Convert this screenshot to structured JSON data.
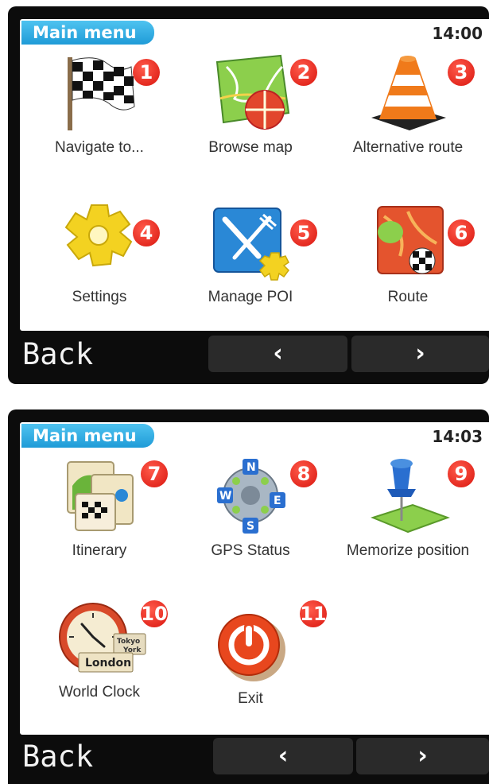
{
  "screens": [
    {
      "title": "Main menu",
      "clock": "14:00",
      "items": [
        {
          "label": "Navigate to...",
          "badge": "1",
          "icon": "checkered-flag-icon"
        },
        {
          "label": "Browse map",
          "badge": "2",
          "icon": "map-icon"
        },
        {
          "label": "Alternative route",
          "badge": "3",
          "icon": "traffic-cone-icon"
        },
        {
          "label": "Settings",
          "badge": "4",
          "icon": "gear-icon"
        },
        {
          "label": "Manage POI",
          "badge": "5",
          "icon": "fork-knife-poi-icon"
        },
        {
          "label": "Route",
          "badge": "6",
          "icon": "route-map-icon"
        }
      ],
      "back_label": "Back",
      "prev_label": "‹",
      "next_label": "›"
    },
    {
      "title": "Main menu",
      "clock": "14:03",
      "items": [
        {
          "label": "Itinerary",
          "badge": "7",
          "icon": "itinerary-icon"
        },
        {
          "label": "GPS Status",
          "badge": "8",
          "icon": "compass-icon"
        },
        {
          "label": "Memorize position",
          "badge": "9",
          "icon": "pushpin-icon"
        },
        {
          "label": "World Clock",
          "badge": "10",
          "icon": "clock-icon",
          "sign_top": "Tokyo",
          "sign_mid": "York",
          "sign_main": "London"
        },
        {
          "label": "Exit",
          "badge": "11",
          "icon": "power-icon"
        }
      ],
      "back_label": "Back",
      "prev_label": "‹",
      "next_label": "›"
    }
  ]
}
